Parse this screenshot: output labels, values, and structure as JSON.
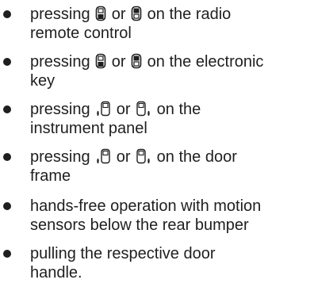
{
  "items": [
    {
      "lines": [
        {
          "pre": "pressing",
          "icon1": "rear-door-close-icon",
          "mid": "or",
          "icon2": "rear-door-open-icon",
          "post": "on the radio"
        },
        {
          "text": "remote control"
        }
      ]
    },
    {
      "lines": [
        {
          "pre": "pressing",
          "icon1": "rear-door-close-icon",
          "mid": "or",
          "icon2": "rear-door-open-icon",
          "post": "on the electronic"
        },
        {
          "text": "key"
        }
      ]
    },
    {
      "lines": [
        {
          "pre": "pressing",
          "icon1": "left-sliding-door-icon",
          "mid": "or",
          "icon2": "right-sliding-door-icon",
          "post": "on the"
        },
        {
          "text": "instrument panel"
        }
      ]
    },
    {
      "lines": [
        {
          "pre": "pressing",
          "icon1": "left-sliding-door-icon",
          "mid": "or",
          "icon2": "right-sliding-door-icon",
          "post": "on the door"
        },
        {
          "text": "frame"
        }
      ]
    },
    {
      "lines": [
        {
          "text": "hands-free operation with motion"
        },
        {
          "text": "sensors below the rear bumper"
        }
      ]
    },
    {
      "lines": [
        {
          "text": "pulling the respective door"
        },
        {
          "text": "handle."
        }
      ]
    }
  ]
}
